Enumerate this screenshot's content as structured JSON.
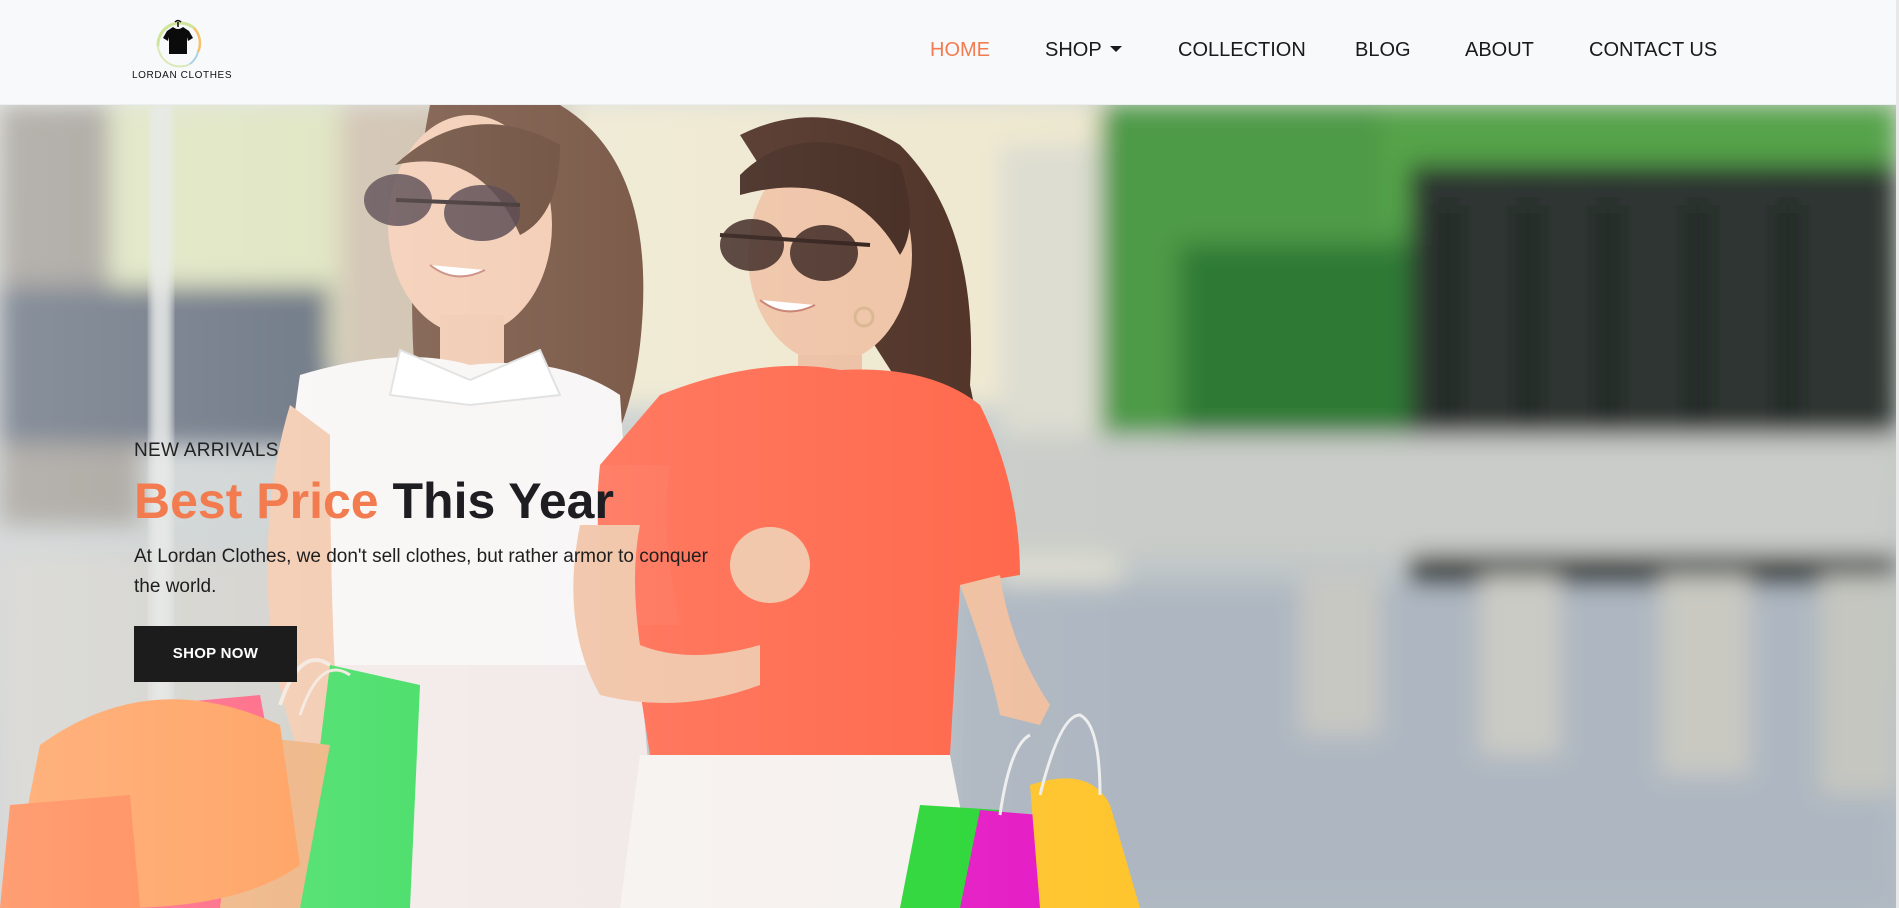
{
  "brand": {
    "name": "LORDAN CLOTHES",
    "logo_icon": "tshirt-icon"
  },
  "nav": {
    "items": [
      {
        "label": "HOME",
        "active": true
      },
      {
        "label": "SHOP",
        "has_dropdown": true
      },
      {
        "label": "COLLECTION"
      },
      {
        "label": "BLOG"
      },
      {
        "label": "ABOUT"
      },
      {
        "label": "CONTACT US"
      }
    ]
  },
  "hero": {
    "eyebrow": "NEW ARRIVALS",
    "headline_accent": "Best Price",
    "headline_rest": "This Year",
    "description": "At Lordan Clothes, we don't sell clothes, but rather armor to conquer the world.",
    "cta_label": "SHOP NOW"
  },
  "colors": {
    "accent": "#f27c50",
    "dark": "#1c1c1c",
    "header_bg": "#f8f9fb"
  }
}
